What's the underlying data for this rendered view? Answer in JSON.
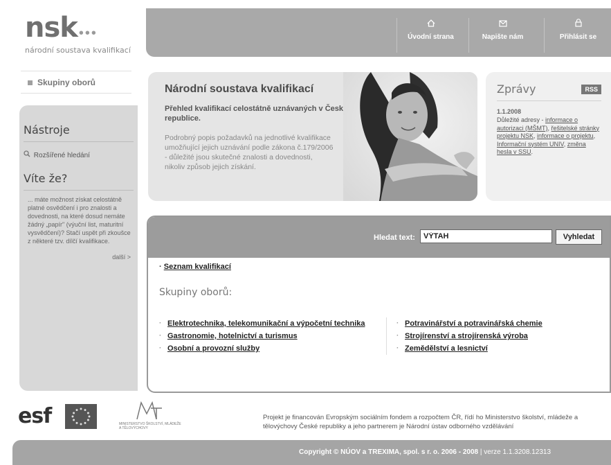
{
  "logo": {
    "mark": "nsk",
    "dots": "•••",
    "subtitle": "národní soustava kvalifikací"
  },
  "nav": {
    "home": {
      "icon": "home-icon",
      "label": "Úvodní strana"
    },
    "mail": {
      "icon": "envelope-icon",
      "label": "Napište nám"
    },
    "login": {
      "icon": "lock-icon",
      "label": "Přihlásit se"
    }
  },
  "sidebar": {
    "skupiny": "Skupiny oborů",
    "tools_heading": "Nástroje",
    "advanced_search": "Rozšířené hledání",
    "did_you_know_heading": "Víte že?",
    "did_you_know_text": "... máte možnost získat celostátně platné osvědčení i pro znalosti a dovednosti, na které dosud nemáte žádný „papír\" (výuční list, maturitní vysvědčení)? Stačí uspět při zkoušce z některé tzv. dílčí kvalifikace.",
    "more": "další >"
  },
  "hero": {
    "title": "Národní soustava kvalifikací",
    "subtitle": "Přehled kvalifikací celostátně uznávaných v České republice.",
    "description": "Podrobný popis požadavků na jednotlivé kvalifikace umožňující jejich uznávání podle zákona č.179/2006 - důležité jsou skutečné znalosti a dovednosti, nikoliv způsob jejich získání."
  },
  "news": {
    "title": "Zprávy",
    "rss": "RSS",
    "date": "1.1.2008",
    "text_prefix": "Důležité adresy - ",
    "links": [
      "informace o autorizaci (MŠMT)",
      "řešitelské stránky projektu NSK",
      "informace o projektu",
      "Informační systém UNIV",
      "změna hesla v SSU"
    ]
  },
  "search": {
    "label": "Hledat text:",
    "value": "VÝTAH",
    "button": "Vyhledat"
  },
  "seznam_link": "Seznam kvalifikací",
  "groups_title": "Skupiny oborů:",
  "groups_left": [
    "Elektrotechnika, telekomunikační a výpočetní technika",
    "Gastronomie, hotelnictví a turismus",
    "Osobní a provozní služby"
  ],
  "groups_right": [
    "Potravinářství a potravinářská chemie",
    "Strojírenství a strojírenská výroba",
    "Zemědělství a lesnictví"
  ],
  "footer": {
    "esf": "esf",
    "msmt_text": "MINISTERSTVO ŠKOLSTVÍ, MLÁDEŽE A TĚLOVÝCHOVY",
    "project_text": "Projekt je financován Evropským sociálním fondem a rozpočtem ČR, řídí ho Ministerstvo školství, mládeže a tělovýchovy České republiky a jeho partnerem je Národní ústav odborného vzdělávání",
    "copyright": "Copyright © NÚOV a TREXIMA, spol. s r. o. 2006 - 2008",
    "version": "| verze 1.1.3208.12313"
  }
}
